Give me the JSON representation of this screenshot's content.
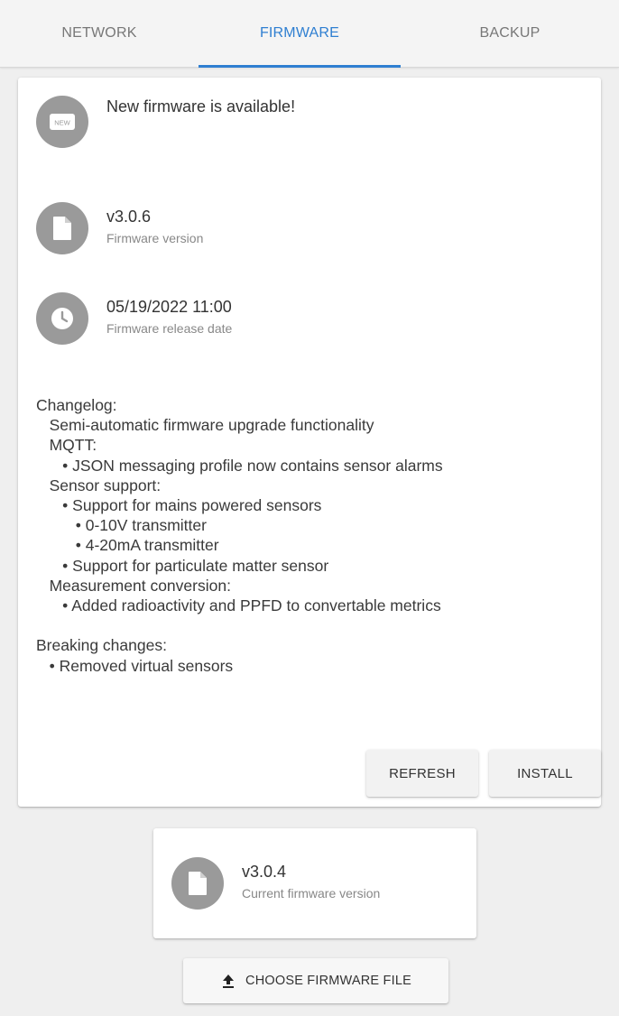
{
  "tabs": [
    {
      "label": "NETWORK",
      "active": false
    },
    {
      "label": "FIRMWARE",
      "active": true
    },
    {
      "label": "BACKUP",
      "active": false
    }
  ],
  "accent_color": "#2f7fd1",
  "update": {
    "badge_text": "NEW",
    "badge_icon": "new-badge-icon",
    "title": "New firmware is available!",
    "version": "v3.0.6",
    "version_label": "Firmware version",
    "version_icon": "file-icon",
    "release_date": "05/19/2022 11:00",
    "release_date_label": "Firmware release date",
    "release_date_icon": "clock-icon",
    "changelog": "Changelog:\n   Semi-automatic firmware upgrade functionality\n   MQTT:\n      • JSON messaging profile now contains sensor alarms\n   Sensor support:\n      • Support for mains powered sensors\n         • 0-10V transmitter\n         • 4-20mA transmitter\n      • Support for particulate matter sensor\n   Measurement conversion:\n      • Added radioactivity and PPFD to convertable metrics\n\nBreaking changes:\n   • Removed virtual sensors"
  },
  "actions": {
    "refresh_label": "REFRESH",
    "install_label": "INSTALL"
  },
  "current": {
    "version": "v3.0.4",
    "label": "Current firmware version",
    "icon": "file-icon"
  },
  "upload": {
    "label": "CHOOSE FIRMWARE FILE",
    "icon": "upload-icon"
  }
}
